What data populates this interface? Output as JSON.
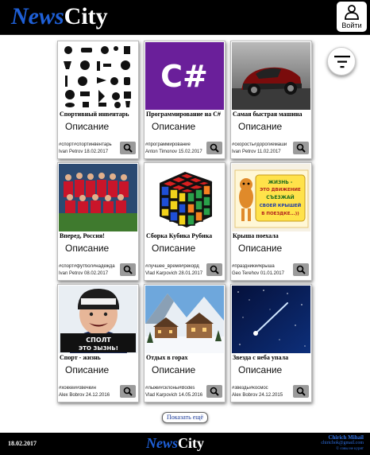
{
  "header": {
    "logo_part1": "News",
    "logo_part2": "City",
    "login_label": "Войти"
  },
  "cards": [
    {
      "title": "Спортивный инвентарь",
      "description": "Описание",
      "tags": "#спорт#спортинвентарь",
      "author": "Ivan Petrov",
      "date": "18.02.2017",
      "image": "sport-equipment-icons"
    },
    {
      "title": "Программирование на C#",
      "description": "Описание",
      "tags": "#программирование",
      "author": "Anton Timonov",
      "date": "15.02.2017",
      "image": "csharp-logo",
      "image_text": "C#"
    },
    {
      "title": "Самая быстрая машина",
      "description": "Описание",
      "tags": "#скорость#дорогиемаши",
      "author": "Ivan Petrov",
      "date": "11.02.2017",
      "image": "sports-car"
    },
    {
      "title": "Вперед, Россия!",
      "description": "Описание",
      "tags": "#спорт#футбол#надежда",
      "author": "Ivan Petrov",
      "date": "08.02.2017",
      "image": "football-team"
    },
    {
      "title": "Сборка Кубика Рубика",
      "description": "Описание",
      "tags": "#лучшее_время#рекорд",
      "author": "Vlad Karpovich",
      "date": "28.01.2017",
      "image": "rubiks-cube"
    },
    {
      "title": "Крыша поехала",
      "description": "Описание",
      "tags": "#праздники#крыша",
      "author": "Geo Terehov",
      "date": "01.01.2017",
      "image": "cartoon-cat-sign",
      "image_text": [
        "ЖИЗНЬ -",
        "ЭТО ДВИЖЕНИЕ",
        "СЪЕЗЖАЙ",
        "СВОЕЙ КРЫШЕЙ",
        "В ПОЕЗДКЕ...))"
      ]
    },
    {
      "title": "Спорт - жизнь",
      "description": "Описание",
      "tags": "#хоккей#овечкин",
      "author": "Alex Bobrov",
      "date": "24.12.2016",
      "image": "hockey-player",
      "image_text": [
        "СПОЛТ",
        "ЭТО ЗЫЗНЬ!"
      ]
    },
    {
      "title": "Отдых в горах",
      "description": "Описание",
      "tags": "#лыжи#склоны#Bodes",
      "author": "Vlad Karpovich",
      "date": "14.05.2016",
      "image": "mountain-chalet"
    },
    {
      "title": "Звезда с неба упала",
      "description": "Описание",
      "tags": "#звезды#космос",
      "author": "Alex Bobrov",
      "date": "24.12.2015",
      "image": "night-sky-comet"
    }
  ],
  "more_button": "Показать ещё",
  "footer": {
    "date": "18.02.2017",
    "logo_part1": "News",
    "logo_part2": "City",
    "author_name": "Chirich Mihail",
    "author_email": "chirichok@gmail.com",
    "copyright": "© совы не курят"
  }
}
